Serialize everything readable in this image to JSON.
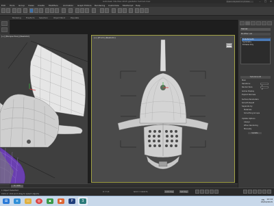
{
  "titlebar": {
    "title": "Autodesk 3ds Max 2015   gladiator helmet.max",
    "search_placeholder": "Type a keyword or phrase"
  },
  "menubar": {
    "items": [
      "Edit",
      "Tools",
      "Group",
      "Views",
      "Create",
      "Modifiers",
      "Animation",
      "Graph Editors",
      "Rendering",
      "Customize",
      "MAXScript",
      "Help"
    ]
  },
  "ribbon": {
    "labels": [
      "Modeling",
      "Freeform",
      "Selection",
      "Object Paint",
      "Populate"
    ]
  },
  "viewports": {
    "left_label": "[+] [Perspective] [Realistic]",
    "main_label": "[+] [Front] [Realistic]",
    "view_cube_label": "FRONT"
  },
  "command_panel": {
    "object_name": "Helmet",
    "modifier_list": "Modifier List",
    "stack": [
      "TurboSmooth",
      "Symmetry",
      "Editable Poly"
    ],
    "rollout_title": "TurboSmooth",
    "main_label": "Main",
    "iterations_label": "Iterations:",
    "iterations_value": "1",
    "render_iters_label": "Render Iters:",
    "render_iters_value": "2",
    "isoline_label": "Isoline Display",
    "explicit_label": "Explicit Normals",
    "surface_label": "Surface Parameters",
    "smooth_result_label": "Smooth Result",
    "separate_label": "Separate by:",
    "materials_label": "Materials",
    "groups_label": "Smoothing Groups",
    "update_label": "Update Options",
    "always_label": "Always",
    "when_render_label": "When Rendering",
    "manually_label": "Manually",
    "update_button": "Update"
  },
  "timebar": {
    "frame": "0 / 100"
  },
  "statusbar": {
    "selection": "1 Object Selected",
    "prompt": "Click or click-and-drag to select objects",
    "coords": "X:   Y:   Z:",
    "grid": "Grid = 10,0cm",
    "autokey": "Auto Key",
    "setkey": "Set Key"
  },
  "taskbar": {
    "tray_lang": "EN",
    "time": "12:14",
    "date": "03/02/2015"
  },
  "colors": {
    "viewport_border": "#a3a346",
    "selection_blue": "#4a79b4",
    "helmet_fill": "#d4d4d4",
    "lining_purple": "#6a3fb0"
  }
}
